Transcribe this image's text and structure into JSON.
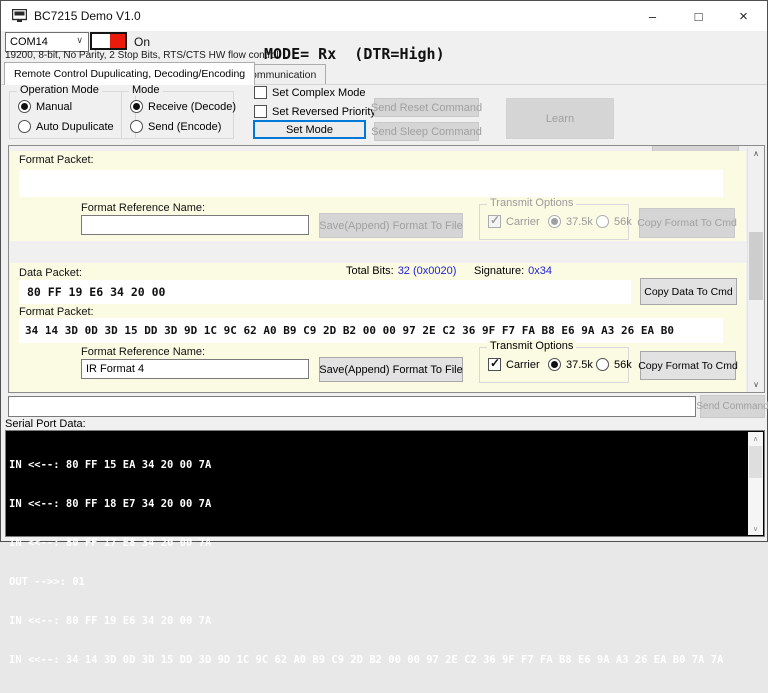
{
  "window": {
    "title": "BC7215 Demo V1.0",
    "controls": {
      "minimize": "–",
      "maximize": "□",
      "close": "×"
    }
  },
  "icons": {
    "scroll_up": "∧",
    "scroll_down": "∨",
    "combo_chevron": "∨"
  },
  "toolbar": {
    "com_port_value": "COM14",
    "toggle_label": "On",
    "serial_config": "19200, 8-bit, No Parity, 2 Stop Bits, RTS/CTS HW flow control",
    "mode_status": "MODE= Rx  (DTR=High)"
  },
  "tabs": {
    "tab1": "Remote Control Dupulicating, Decoding/Encoding",
    "tab2": "IR Communication"
  },
  "mode_panel": {
    "operation_group_title": "Operation Mode",
    "radio_manual": "Manual",
    "radio_auto": "Auto Dupulicate",
    "mode_group_title": "Mode",
    "radio_receive": "Receive (Decode)",
    "radio_send": "Send (Encode)",
    "check_complex": "Set Complex Mode",
    "check_reversed": "Set Reversed Priority",
    "set_mode_button": "Set Mode",
    "send_reset_button": "Send Reset Command",
    "send_sleep_button": "Send Sleep Command",
    "learn_button": "Learn"
  },
  "format_top": {
    "packet_label": "Format Packet:",
    "packet_value": "",
    "ref_label": "Format Reference Name:",
    "ref_value": "",
    "save_button": "Save(Append) Format To File",
    "transmit": {
      "title": "Transmit Options",
      "carrier": "Carrier",
      "freq_375": "37.5k",
      "freq_56": "56k"
    },
    "copy_button": "Copy Format To Cmd"
  },
  "data_packet": {
    "label": "Data Packet:",
    "total_bits_label": "Total Bits:",
    "total_bits_value": "32 (0x0020)",
    "signature_label": "Signature:",
    "signature_value": "0x34",
    "value": "80 FF 19 E6 34 20 00",
    "copy_button": "Copy Data To Cmd"
  },
  "format_bottom": {
    "packet_label": "Format Packet:",
    "packet_value": "34 14 3D 0D 3D 15 DD 3D 9D 1C 9C 62 A0 B9 C9 2D B2 00 00 97 2E C2 36 9F F7 FA B8 E6 9A A3 26 EA B0",
    "ref_label": "Format Reference Name:",
    "ref_value": "IR Format 4",
    "save_button": "Save(Append) Format To File",
    "transmit": {
      "title": "Transmit Options",
      "carrier": "Carrier",
      "freq_375": "37.5k",
      "freq_56": "56k"
    },
    "copy_button": "Copy Format To Cmd"
  },
  "command_bar": {
    "input_value": "",
    "send_button": "Send Command"
  },
  "serial_monitor": {
    "label": "Serial Port Data:",
    "lines": [
      "IN <<--: 80 FF 15 EA 34 20 00 7A",
      "IN <<--: 80 FF 18 E7 34 20 00 7A",
      "IN <<--: 80 FF 17 E8 34 20 00 7A",
      "OUT -->>: 01",
      "IN <<--: 80 FF 19 E6 34 20 00 7A",
      "IN <<--: 34 14 3D 0D 3D 15 DD 3D 9D 1C 9C 62 A0 B9 C9 2D B2 00 00 97 2E C2 36 9F F7 FA B8 E6 9A A3 26 EA B0 7A 7A"
    ]
  },
  "colors": {
    "accent_value_blue": "#2121d6",
    "focus_border_blue": "#0078d7",
    "panel_yellow": "#fbfae2",
    "toggle_red": "#ea1b0d",
    "terminal_bg": "#000000",
    "terminal_text": "#ffffff"
  }
}
